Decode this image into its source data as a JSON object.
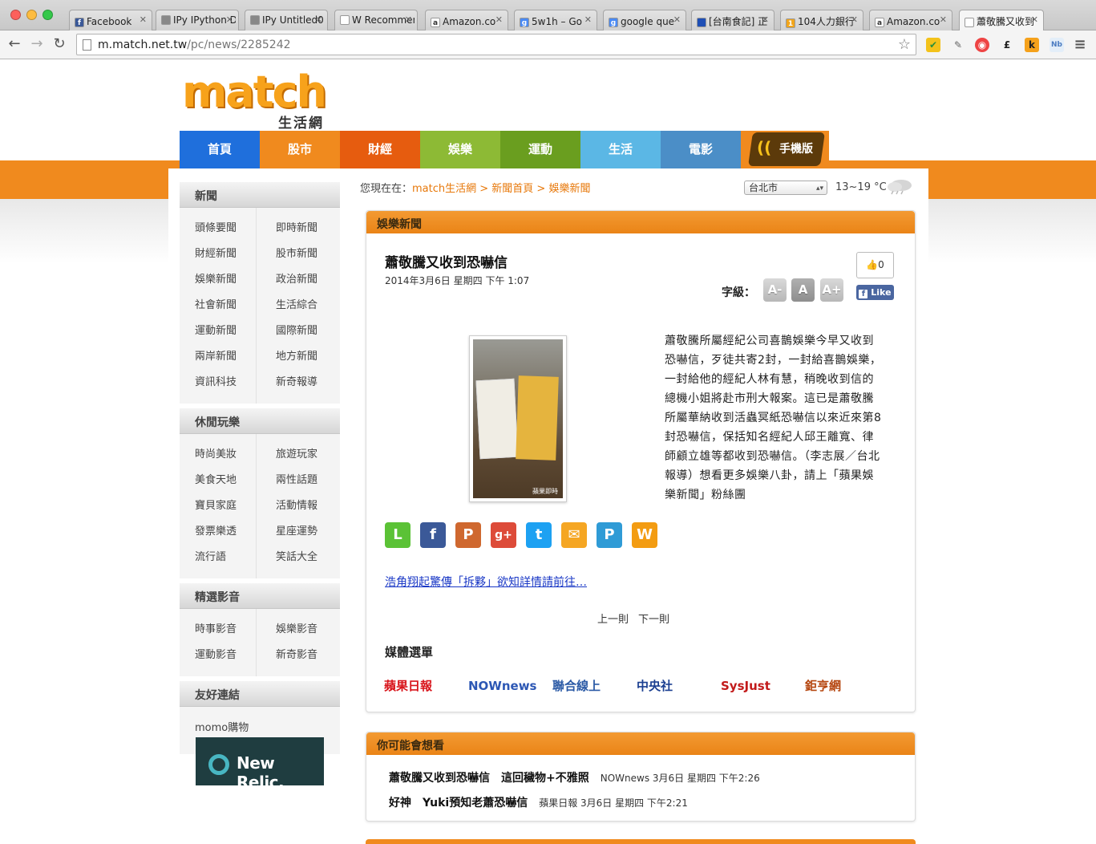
{
  "browser": {
    "tabs": [
      {
        "title": "Facebook",
        "icon": "facebook-icon",
        "color": "#3b5998",
        "glyph": "f"
      },
      {
        "title": "IPy IPython Da",
        "icon": "ipython-icon",
        "color": "#888888",
        "glyph": ""
      },
      {
        "title": "IPy Untitled0",
        "icon": "ipython-icon",
        "color": "#888888",
        "glyph": ""
      },
      {
        "title": "W Recommen",
        "icon": "wikipedia-icon",
        "color": "#ffffff",
        "glyph": ""
      },
      {
        "title": "Amazon.co",
        "icon": "amazon-icon",
        "color": "#ffffff",
        "glyph": "a"
      },
      {
        "title": "5w1h – Go",
        "icon": "google-icon",
        "color": "#4a8af4",
        "glyph": "g"
      },
      {
        "title": "google que",
        "icon": "google-icon",
        "color": "#4a8af4",
        "glyph": "g"
      },
      {
        "title": "[台南食記] 正",
        "icon": "blog-icon",
        "color": "#1f4fb5",
        "glyph": ""
      },
      {
        "title": "104人力銀行",
        "icon": "104-icon",
        "color": "#f2a51a",
        "glyph": "1"
      },
      {
        "title": "Amazon.co",
        "icon": "amazon-icon",
        "color": "#ffffff",
        "glyph": "a"
      },
      {
        "title": "蕭敬騰又收到",
        "icon": "page-icon",
        "color": "#ffffff",
        "glyph": ""
      }
    ],
    "url_host": "m.match.net.tw",
    "url_path": "/pc/news/2285242"
  },
  "site": {
    "logo_text": "match",
    "logo_sub": "生活網",
    "nav": [
      {
        "label": "首頁",
        "color": "#1f6fdc"
      },
      {
        "label": "股市",
        "color": "#f08a1e"
      },
      {
        "label": "財經",
        "color": "#e65c0f"
      },
      {
        "label": "娛樂",
        "color": "#8dba35"
      },
      {
        "label": "運動",
        "color": "#6a9e1f"
      },
      {
        "label": "生活",
        "color": "#5bb7e5"
      },
      {
        "label": "電影",
        "color": "#4b8ec7"
      }
    ],
    "mobile_label": "手機版"
  },
  "sidebar": {
    "sections": [
      {
        "title": "新聞",
        "items": [
          "頭條要聞",
          "即時新聞",
          "財經新聞",
          "股市新聞",
          "娛樂新聞",
          "政治新聞",
          "社會新聞",
          "生活綜合",
          "運動新聞",
          "國際新聞",
          "兩岸新聞",
          "地方新聞",
          "資訊科技",
          "新奇報導"
        ]
      },
      {
        "title": "休閒玩樂",
        "items": [
          "時尚美妝",
          "旅遊玩家",
          "美食天地",
          "兩性話題",
          "寶貝家庭",
          "活動情報",
          "發票樂透",
          "星座運勢",
          "流行語",
          "笑話大全"
        ]
      },
      {
        "title": "精選影音",
        "items": [
          "時事影音",
          "娛樂影音",
          "運動影音",
          "新奇影音"
        ]
      }
    ],
    "links_title": "友好連結",
    "links_item": "momo購物",
    "ad_text": "New Relic."
  },
  "breadcrumb": {
    "prefix": "您現在在：",
    "path": "match生活網 > 新聞首頁 > 娛樂新聞"
  },
  "weather": {
    "city": "台北市",
    "temp": "13~19 °C"
  },
  "article": {
    "section": "娛樂新聞",
    "title": "蕭敬騰又收到恐嚇信",
    "date": "2014年3月6日 星期四 下午 1:07",
    "like_count": "0",
    "like_label": "Like",
    "font_label": "字級：",
    "font_buttons": [
      "A-",
      "A",
      "A+"
    ],
    "photo_credit": "蘋果即時",
    "body": "蕭敬騰所屬經紀公司喜鵲娛樂今早又收到恐嚇信，歹徒共寄2封，一封給喜鵲娛樂，一封給他的經紀人林有慧，稍晚收到信的總機小姐將赴市刑大報案。這已是蕭敬騰所屬華納收到活蟲冥紙恐嚇信以來近來第8封恐嚇信，保括知名經紀人邱王離寬、律師顧立雄等都收到恐嚇信。（李志展／台北報導）想看更多娛樂八卦，請上「蘋果娛樂新聞」粉絲團",
    "share": [
      {
        "name": "line-icon",
        "color": "#5bc236",
        "glyph": "L"
      },
      {
        "name": "facebook-icon",
        "color": "#3b5998",
        "glyph": "f"
      },
      {
        "name": "plurk-icon",
        "color": "#cf682f",
        "glyph": "P"
      },
      {
        "name": "google-plus-icon",
        "color": "#dd4b39",
        "glyph": "g+"
      },
      {
        "name": "twitter-icon",
        "color": "#1da1f2",
        "glyph": "t"
      },
      {
        "name": "email-icon",
        "color": "#f5a623",
        "glyph": "✉"
      },
      {
        "name": "search-share-icon",
        "color": "#2f9bd6",
        "glyph": "P"
      },
      {
        "name": "weibo-icon",
        "color": "#f39c12",
        "glyph": "W"
      }
    ],
    "related_link": "浩角翔起驚傳「拆夥」欲知詳情請前往…",
    "prev": "上一則",
    "next": "下一則",
    "media_title": "媒體選單",
    "media": [
      {
        "label": "蘋果日報",
        "color": "#d8141b"
      },
      {
        "label": "NOWnews",
        "color": "#2c57b4"
      },
      {
        "label": "聯合線上",
        "color": "#2b5aa6"
      },
      {
        "label": "中央社",
        "color": "#1b3f91"
      },
      {
        "label": "SysJust",
        "color": "#c21a1a"
      },
      {
        "label": "鉅亨網",
        "color": "#b5460f"
      }
    ]
  },
  "maybe": {
    "title": "你可能會想看",
    "items": [
      {
        "title": "蕭敬騰又收到恐嚇信",
        "title2": "這回穢物+不雅照",
        "meta": "NOWnews 3月6日 星期四 下午2:26"
      },
      {
        "title": "好神",
        "title2": "Yuki預知老蕭恐嚇信",
        "meta": "蘋果日報 3月6日 星期四 下午2:21"
      }
    ]
  }
}
